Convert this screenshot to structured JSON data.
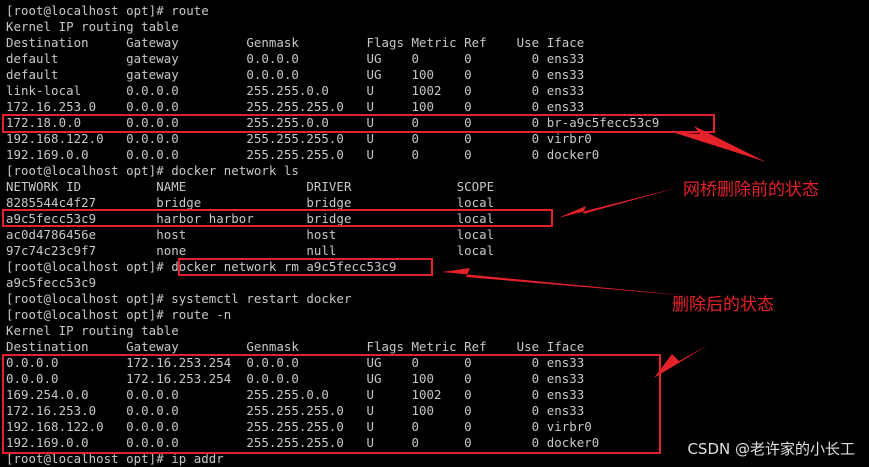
{
  "terminal": {
    "lines": [
      "[root@localhost opt]# route",
      "Kernel IP routing table",
      "Destination     Gateway         Genmask         Flags Metric Ref    Use Iface",
      "default         gateway         0.0.0.0         UG    0      0        0 ens33",
      "default         gateway         0.0.0.0         UG    100    0        0 ens33",
      "link-local      0.0.0.0         255.255.0.0     U     1002   0        0 ens33",
      "172.16.253.0    0.0.0.0         255.255.255.0   U     100    0        0 ens33",
      "172.18.0.0      0.0.0.0         255.255.0.0     U     0      0        0 br-a9c5fecc53c9",
      "192.168.122.0   0.0.0.0         255.255.255.0   U     0      0        0 virbr0",
      "192.169.0.0     0.0.0.0         255.255.255.0   U     0      0        0 docker0",
      "[root@localhost opt]# docker network ls",
      "NETWORK ID          NAME                DRIVER              SCOPE",
      "8285544c4f27        bridge              bridge              local",
      "a9c5fecc53c9        harbor_harbor       bridge              local",
      "ac0d4786456e        host                host                local",
      "97c74c23c9f7        none                null                local",
      "[root@localhost opt]# docker network rm a9c5fecc53c9",
      "a9c5fecc53c9",
      "[root@localhost opt]# systemctl restart docker",
      "[root@localhost opt]# route -n",
      "Kernel IP routing table",
      "Destination     Gateway         Genmask         Flags Metric Ref    Use Iface",
      "0.0.0.0         172.16.253.254  0.0.0.0         UG    0      0        0 ens33",
      "0.0.0.0         172.16.253.254  0.0.0.0         UG    100    0        0 ens33",
      "169.254.0.0     0.0.0.0         255.255.0.0     U     1002   0        0 ens33",
      "172.16.253.0    0.0.0.0         255.255.255.0   U     100    0        0 ens33",
      "192.168.122.0   0.0.0.0         255.255.255.0   U     0      0        0 virbr0",
      "192.169.0.0     0.0.0.0         255.255.255.0   U     0      0        0 docker0",
      "[root@localhost opt]# ip addr"
    ]
  },
  "annotations": {
    "before_delete": "网桥删除前的状态",
    "after_delete": "删除后的状态"
  },
  "watermark": "CSDN @老许家的小长工",
  "colors": {
    "background": "#000000",
    "text": "#c8c8c8",
    "highlight": "#e5212a"
  }
}
